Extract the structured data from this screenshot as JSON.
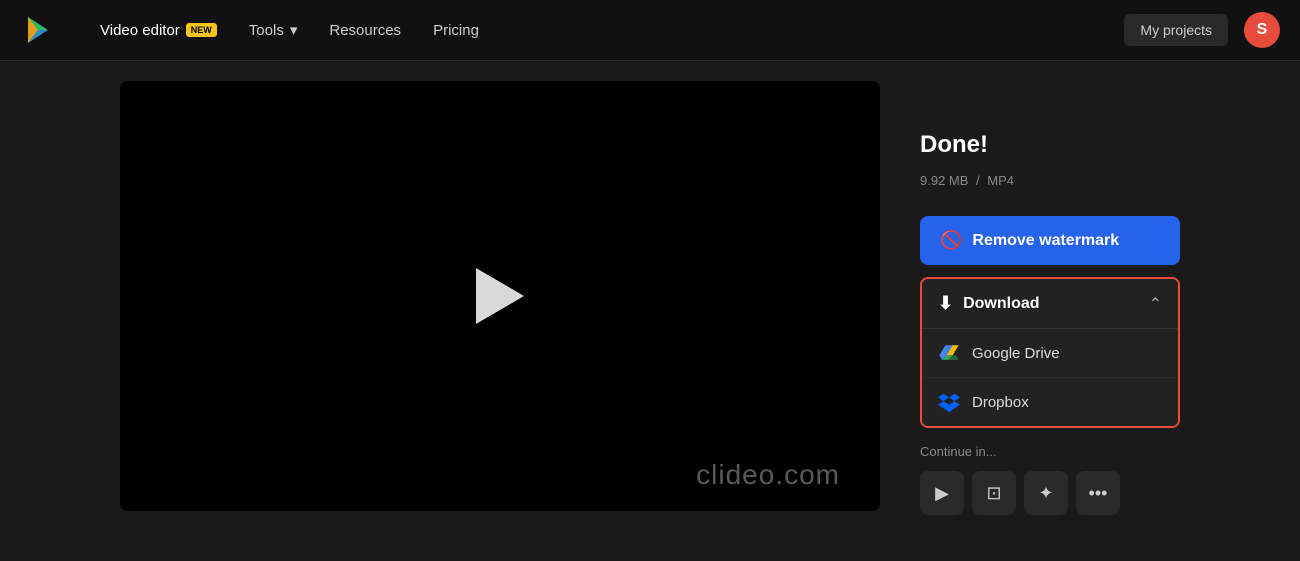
{
  "header": {
    "logo_alt": "Clideo logo",
    "nav_items": [
      {
        "label": "Video editor",
        "badge": "NEW",
        "has_badge": true,
        "has_chevron": false
      },
      {
        "label": "Tools",
        "has_badge": false,
        "has_chevron": true
      },
      {
        "label": "Resources",
        "has_badge": false,
        "has_chevron": false
      },
      {
        "label": "Pricing",
        "has_badge": false,
        "has_chevron": false
      }
    ],
    "my_projects_label": "My projects",
    "avatar_letter": "S"
  },
  "main": {
    "video": {
      "watermark": "clideo.com"
    },
    "panel": {
      "done_title": "Done!",
      "file_size": "9.92 MB",
      "file_format": "MP4",
      "remove_watermark_label": "Remove watermark",
      "download_label": "Download",
      "google_drive_label": "Google Drive",
      "dropbox_label": "Dropbox",
      "continue_label": "Continue in..."
    }
  }
}
